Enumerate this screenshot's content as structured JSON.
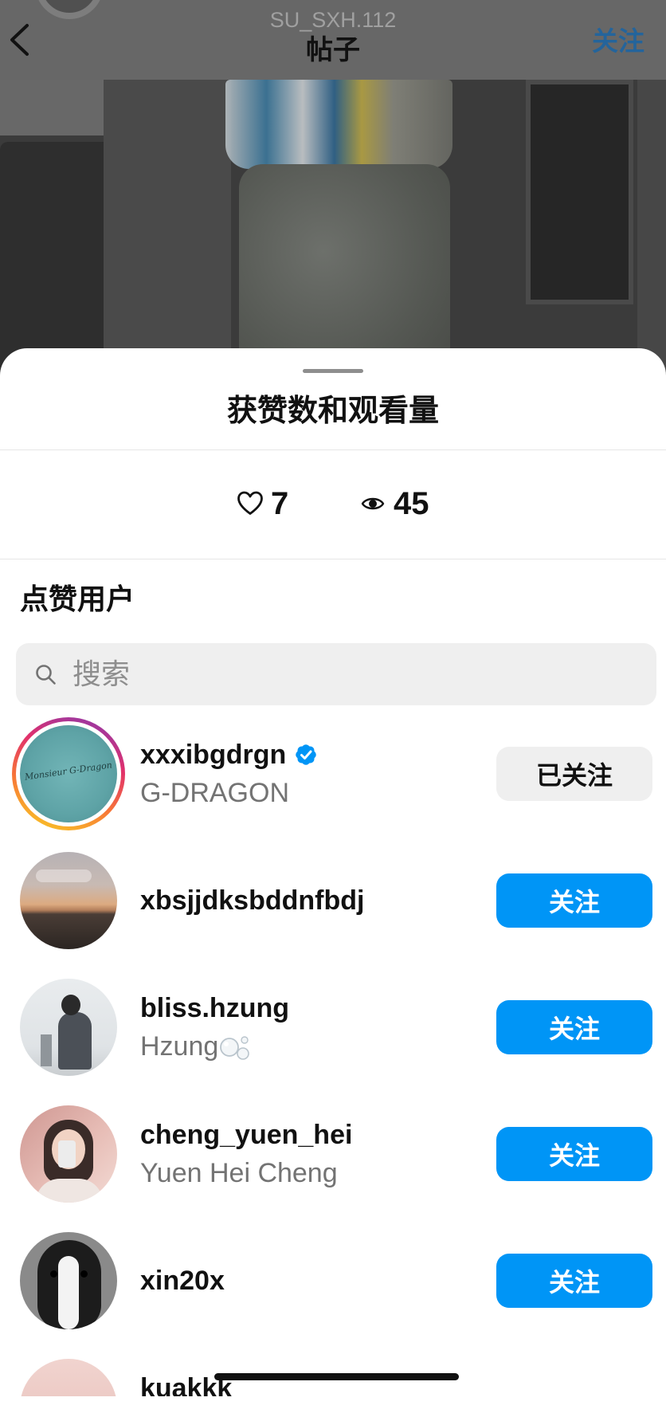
{
  "header": {
    "account_name": "SU_SXH.112",
    "title": "帖子",
    "follow_label": "关注"
  },
  "sheet": {
    "title": "获赞数和观看量",
    "stats": {
      "likes": "7",
      "views": "45"
    },
    "section_title": "点赞用户"
  },
  "search": {
    "placeholder": "搜索"
  },
  "users": [
    {
      "username": "xxxibgdrgn",
      "display_name": "G-DRAGON",
      "verified": true,
      "has_story": true,
      "avatar_lettering": "Monsieur G-Dragon",
      "follow_button": "已关注",
      "following": true
    },
    {
      "username": "xbsjjdksbddnfbdj",
      "follow_button": "关注",
      "following": false
    },
    {
      "username": "bliss.hzung",
      "display_name": "Hzung",
      "display_name_icon": "bubbles-icon",
      "follow_button": "关注",
      "following": false
    },
    {
      "username": "cheng_yuen_hei",
      "display_name": "Yuen Hei Cheng",
      "follow_button": "关注",
      "following": false
    },
    {
      "username": "xin20x",
      "follow_button": "关注",
      "following": false
    },
    {
      "username": "kuakkk"
    }
  ],
  "icons": {
    "back": "chevron-left-icon",
    "likes": "heart-icon",
    "views": "eye-icon",
    "search": "search-icon",
    "verified": "verified-badge-icon"
  },
  "colors": {
    "accent": "#0095f6",
    "secondary_button_bg": "#efefef",
    "secondary_text": "#737373",
    "primary_text": "#111111"
  }
}
